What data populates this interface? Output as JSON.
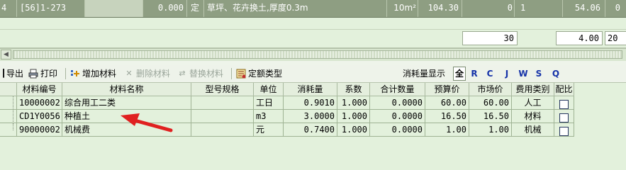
{
  "top_row": {
    "index": "4",
    "code": "[56]1-273",
    "amount": "0.000",
    "type": "定",
    "name": "草坪、花卉换土,厚度0.3m",
    "unit": "10m²",
    "price": "104.30",
    "col_a": "0",
    "col_b": "1",
    "total": "54.06",
    "last": "0"
  },
  "summary_row": {
    "v1": "30",
    "v2": "4.00",
    "v3": "20"
  },
  "toolbar": {
    "export": "导出",
    "print": "打印",
    "add_material": "增加材料",
    "delete_material": "删除材料",
    "replace_material": "替换材料",
    "quota_type": "定额类型",
    "consumption_display": "消耗量显示",
    "filters": [
      "全",
      "R",
      "C",
      "J",
      "W",
      "S",
      "Q"
    ]
  },
  "grid": {
    "columns": [
      "材料编号",
      "材料名称",
      "型号规格",
      "单位",
      "消耗量",
      "系数",
      "合计数量",
      "预算价",
      "市场价",
      "费用类别",
      "配比"
    ],
    "rows": [
      {
        "code": "10000002",
        "name": "综合用工二类",
        "spec": "",
        "unit": "工日",
        "consumption": "0.9010",
        "coef": "1.000",
        "total": "0.0000",
        "budget": "60.00",
        "market": "60.00",
        "category": "人工"
      },
      {
        "code": "CD1Y0056",
        "name": "种植土",
        "spec": "",
        "unit": "m3",
        "consumption": "3.0000",
        "coef": "1.000",
        "total": "0.0000",
        "budget": "16.50",
        "market": "16.50",
        "category": "材料"
      },
      {
        "code": "90000002",
        "name": "机械费",
        "spec": "",
        "unit": "元",
        "consumption": "0.7400",
        "coef": "1.000",
        "total": "0.0000",
        "budget": "1.00",
        "market": "1.00",
        "category": "机械"
      }
    ]
  },
  "colors": {
    "background": "#e3f1dc",
    "selected_row": "#8e9e82",
    "annotation_arrow": "#e02020"
  }
}
